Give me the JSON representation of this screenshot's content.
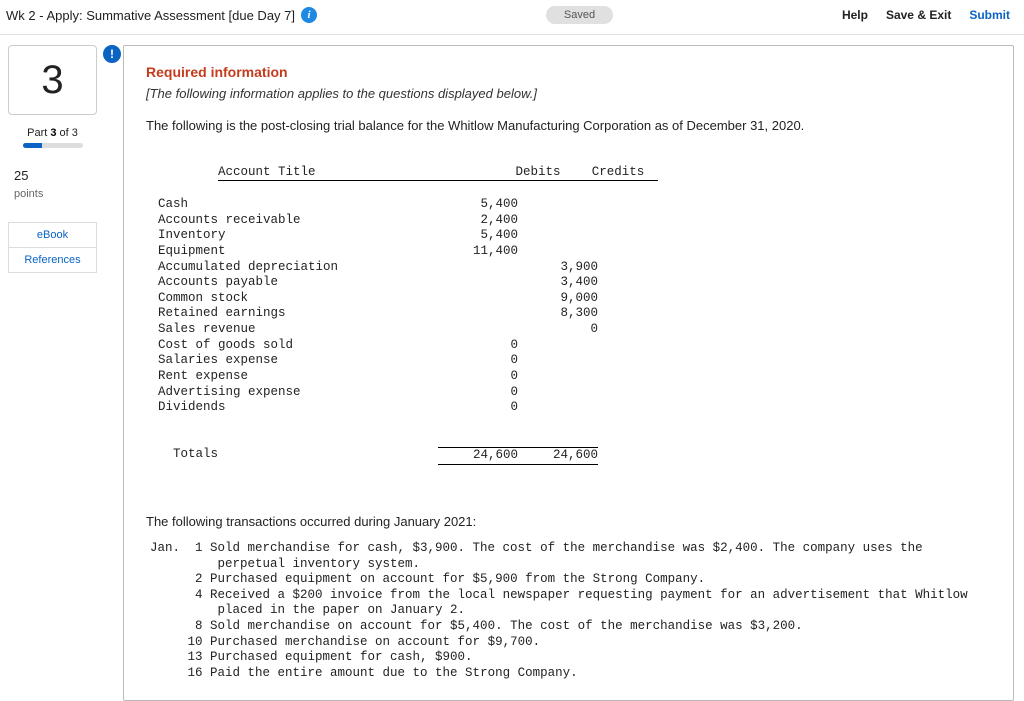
{
  "header": {
    "title": "Wk 2 - Apply: Summative Assessment [due Day 7]",
    "saved_label": "Saved",
    "help_label": "Help",
    "save_exit_label": "Save & Exit",
    "submit_label": "Submit"
  },
  "sidebar": {
    "question_number": "3",
    "part_label_prefix": "Part ",
    "part_current": "3",
    "part_of": " of 3",
    "points_value": "25",
    "points_label": "points",
    "ebook_label": "eBook",
    "references_label": "References"
  },
  "content": {
    "alert": "!",
    "required_title": "Required information",
    "applies_text": "[The following information applies to the questions displayed below.]",
    "intro_text": "The following is the post-closing trial balance for the Whitlow Manufacturing Corporation as of December 31, 2020.",
    "table": {
      "col_title": "Account Title",
      "col_debits": "Debits",
      "col_credits": "Credits",
      "rows": [
        {
          "title": "Cash",
          "d": "5,400",
          "c": ""
        },
        {
          "title": "Accounts receivable",
          "d": "2,400",
          "c": ""
        },
        {
          "title": "Inventory",
          "d": "5,400",
          "c": ""
        },
        {
          "title": "Equipment",
          "d": "11,400",
          "c": ""
        },
        {
          "title": "Accumulated depreciation",
          "d": "",
          "c": "3,900"
        },
        {
          "title": "Accounts payable",
          "d": "",
          "c": "3,400"
        },
        {
          "title": "Common stock",
          "d": "",
          "c": "9,000"
        },
        {
          "title": "Retained earnings",
          "d": "",
          "c": "8,300"
        },
        {
          "title": "Sales revenue",
          "d": "",
          "c": "0"
        },
        {
          "title": "Cost of goods sold",
          "d": "0",
          "c": ""
        },
        {
          "title": "Salaries expense",
          "d": "0",
          "c": ""
        },
        {
          "title": "Rent expense",
          "d": "0",
          "c": ""
        },
        {
          "title": "Advertising expense",
          "d": "0",
          "c": ""
        },
        {
          "title": "Dividends",
          "d": "0",
          "c": ""
        }
      ],
      "totals_label": "  Totals",
      "totals_d": "24,600",
      "totals_c": "24,600"
    },
    "trans_intro": "The following transactions occurred during January 2021:",
    "trans_month": "Jan.",
    "transactions": "Jan.  1 Sold merchandise for cash, $3,900. The cost of the merchandise was $2,400. The company uses the\n         perpetual inventory system.\n      2 Purchased equipment on account for $5,900 from the Strong Company.\n      4 Received a $200 invoice from the local newspaper requesting payment for an advertisement that Whitlow\n         placed in the paper on January 2.\n      8 Sold merchandise on account for $5,400. The cost of the merchandise was $3,200.\n     10 Purchased merchandise on account for $9,700.\n     13 Purchased equipment for cash, $900.\n     16 Paid the entire amount due to the Strong Company."
  }
}
